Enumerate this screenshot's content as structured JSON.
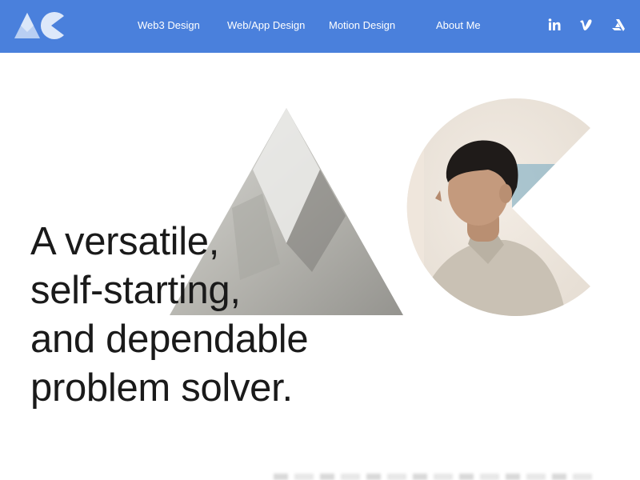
{
  "nav": {
    "logo_alt": "AC",
    "links": [
      "Web3 Design",
      "Web/App Design",
      "Motion Design",
      "About Me"
    ],
    "social": [
      {
        "name": "linkedin-icon",
        "glyph": "in"
      },
      {
        "name": "vimeo-icon",
        "glyph": "v"
      },
      {
        "name": "artstation-icon",
        "glyph": "A"
      }
    ]
  },
  "hero": {
    "headline_lines": [
      "A versatile,",
      "self-starting,",
      "and dependable",
      "problem solver."
    ]
  },
  "colors": {
    "nav_bg": "#4a80dc",
    "text": "#1a1a1a"
  }
}
